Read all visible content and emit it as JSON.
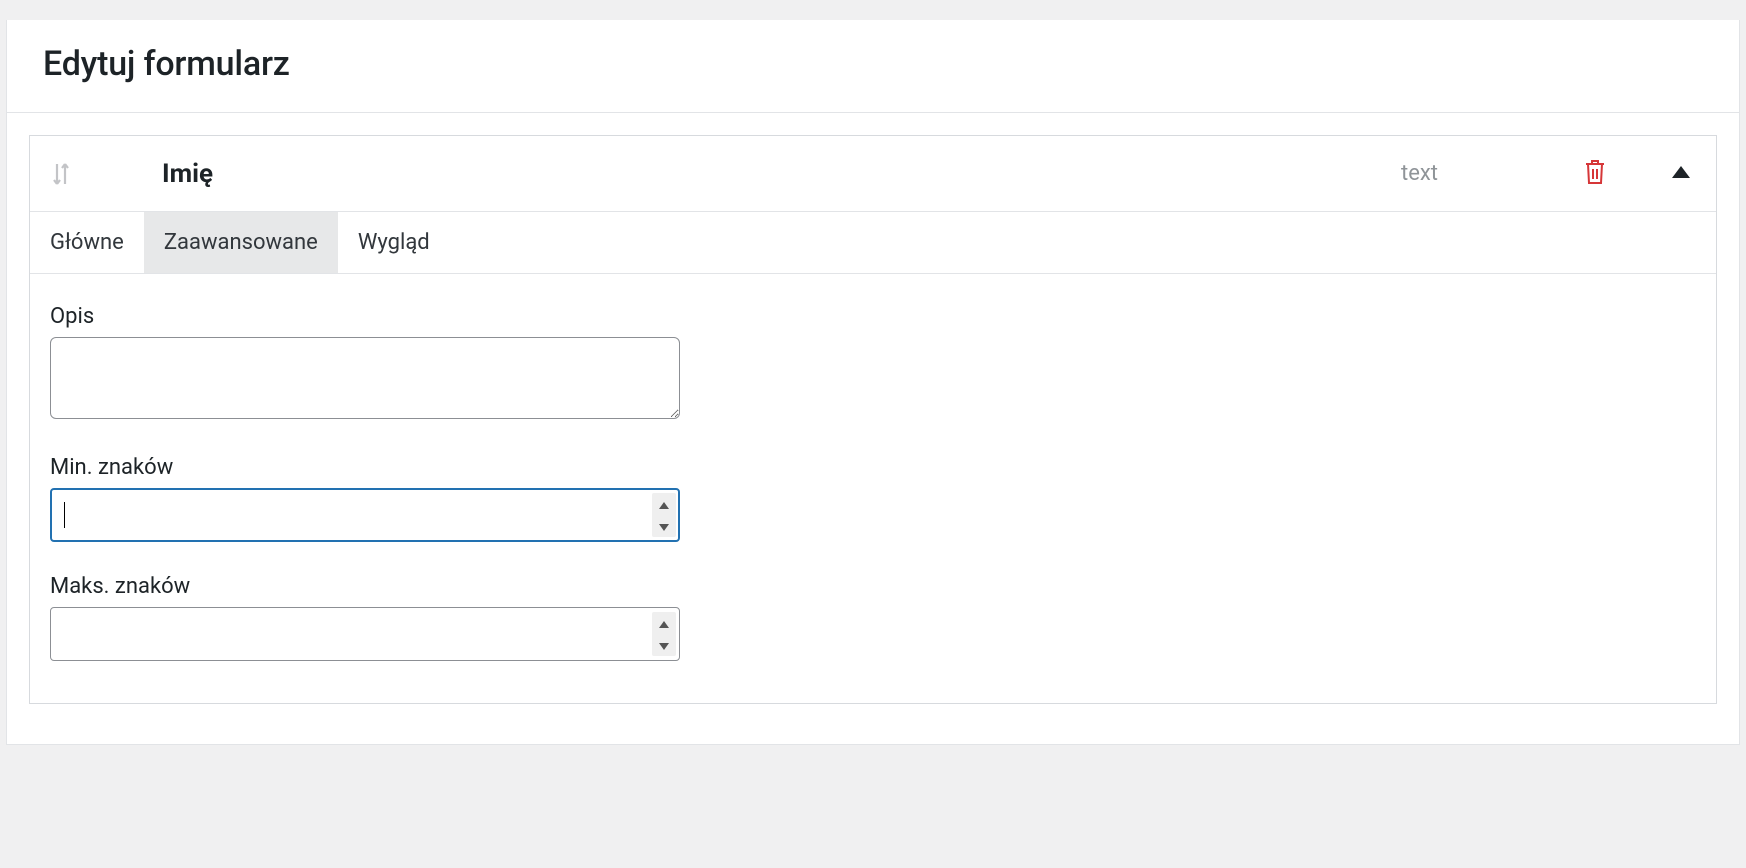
{
  "page": {
    "title": "Edytuj formularz"
  },
  "field": {
    "name": "Imię",
    "type": "text"
  },
  "tabs": {
    "main": "Główne",
    "advanced": "Zaawansowane",
    "appearance": "Wygląd"
  },
  "advanced": {
    "description_label": "Opis",
    "description_value": "",
    "min_chars_label": "Min. znaków",
    "min_chars_value": "",
    "max_chars_label": "Maks. znaków",
    "max_chars_value": ""
  }
}
